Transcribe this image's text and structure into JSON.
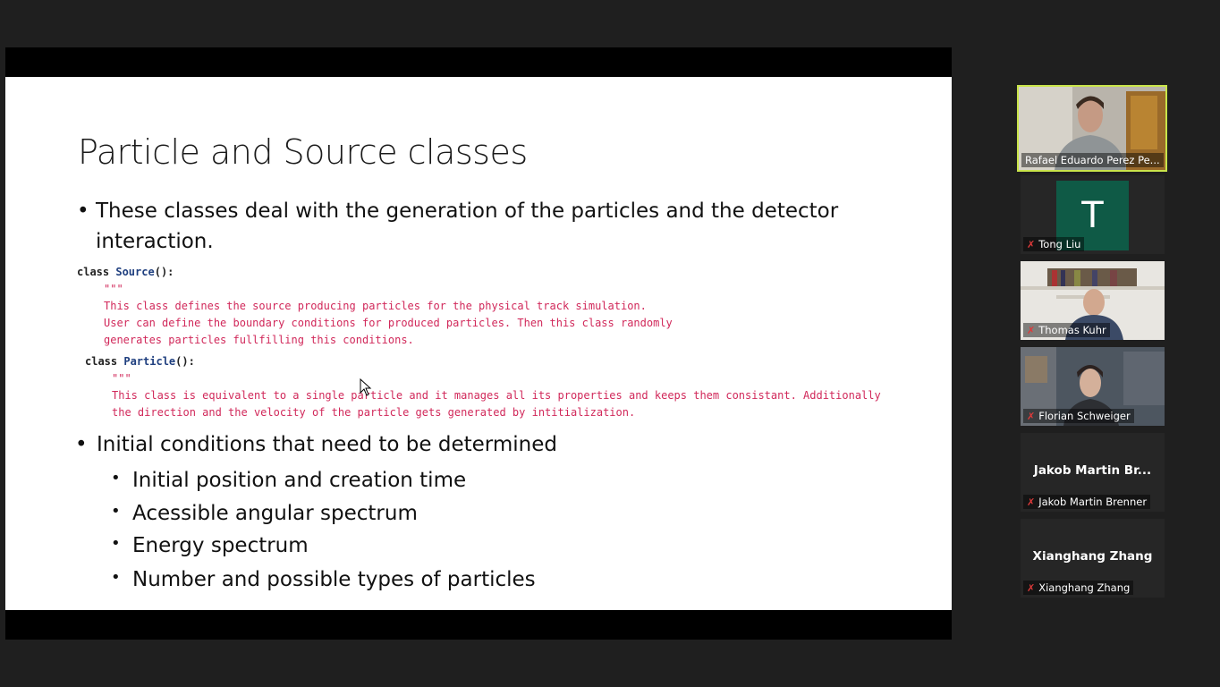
{
  "slide": {
    "title": "Particle and Source classes",
    "bullet1": "These classes deal with the generation of the particles and the detector interaction.",
    "code1": {
      "keyword": "class ",
      "name": "Source",
      "paren": "():",
      "quotes": "\"\"\"",
      "lines": [
        "This class defines the source producing particles for the physical track simulation.",
        "User can define the boundary conditions for produced particles. Then this class randomly",
        "generates particles fullfilling this conditions."
      ]
    },
    "code2": {
      "keyword": "class ",
      "name": "Particle",
      "paren": "():",
      "quotes": "\"\"\"",
      "lines": [
        "This class is equivalent to a single particle and it manages all its properties and keeps them consistant. Additionally",
        "the direction and the velocity of the particle gets generated by intitialization."
      ]
    },
    "bullet2": "Initial conditions that need to be determined",
    "subbullets": [
      "Initial position and creation time",
      "Acessible angular spectrum",
      "Energy spectrum",
      "Number and possible types of particles"
    ]
  },
  "participants": [
    {
      "name": "Rafael Eduardo Perez Pe...",
      "type": "video",
      "speaking": true
    },
    {
      "name": "Tong Liu",
      "type": "avatar",
      "initial": "T",
      "muted": true
    },
    {
      "name": "Thomas Kuhr",
      "type": "video",
      "muted": true
    },
    {
      "name": "Florian Schweiger",
      "type": "video",
      "muted": true
    },
    {
      "name": "Jakob Martin Brenner",
      "display": "Jakob Martin Br...",
      "type": "name",
      "muted": true
    },
    {
      "name": "Xianghang Zhang",
      "display": "Xianghang Zhang",
      "type": "name",
      "muted": true
    }
  ],
  "colors": {
    "speaker_border": "#c9e44a",
    "avatar_bg": "#0f5a46",
    "docstring": "#d1285a",
    "muted_icon": "#e03a3a"
  }
}
